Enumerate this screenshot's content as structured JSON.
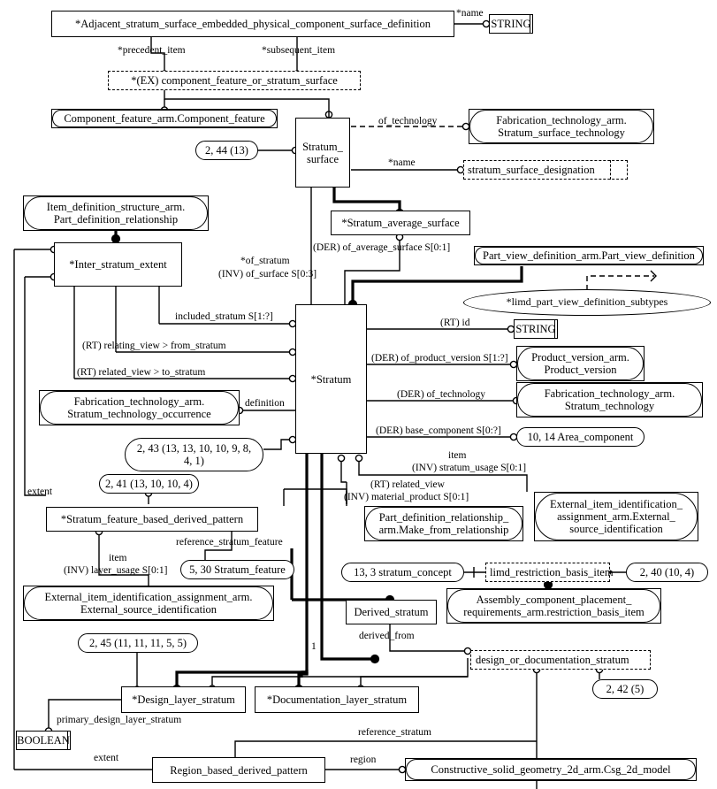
{
  "diagram": {
    "type": "EXPRESS-G entity-level diagram",
    "schema_hint": "layered_interconnect_module_design_arm"
  },
  "nodes": {
    "adjacent_stratum_surface_def": {
      "label": "*Adjacent_stratum_surface_embedded_physical_component_surface_definition",
      "kind": "entity"
    },
    "string_top": {
      "label": "STRING",
      "kind": "simple-type"
    },
    "ex_component_feature_or_stratum_surface": {
      "label": "*(EX) component_feature_or_stratum_surface",
      "kind": "select"
    },
    "component_feature": {
      "label": "Component_feature_arm.Component_feature",
      "kind": "schema-ref"
    },
    "stratum_surface": {
      "label": "Stratum_\nsurface",
      "kind": "entity"
    },
    "pageref_2_44_13": {
      "label": "2, 44 (13)",
      "kind": "page-ref"
    },
    "fab_stratum_surface_technology": {
      "label": "Fabrication_technology_arm.\nStratum_surface_technology",
      "kind": "schema-ref"
    },
    "stratum_surface_designation": {
      "label": "stratum_surface_designation",
      "kind": "defined-type"
    },
    "item_def_structure": {
      "label": "Item_definition_structure_arm.\nPart_definition_relationship",
      "kind": "schema-ref"
    },
    "inter_stratum_extent": {
      "label": "*Inter_stratum_extent",
      "kind": "entity"
    },
    "stratum_average_surface": {
      "label": "*Stratum_average_surface",
      "kind": "entity"
    },
    "part_view_definition": {
      "label": "Part_view_definition_arm.Part_view_definition",
      "kind": "schema-ref"
    },
    "limd_part_view_definition_subtypes": {
      "label": "*limd_part_view_definition_subtypes",
      "kind": "subtype-set"
    },
    "stratum": {
      "label": "*Stratum",
      "kind": "entity"
    },
    "string_id": {
      "label": "STRING",
      "kind": "simple-type"
    },
    "product_version": {
      "label": "Product_version_arm.\nProduct_version",
      "kind": "schema-ref"
    },
    "fab_stratum_technology": {
      "label": "Fabrication_technology_arm.\nStratum_technology",
      "kind": "schema-ref"
    },
    "area_component": {
      "label": "10, 14 Area_component",
      "kind": "page-ref"
    },
    "fab_stratum_technology_occurrence": {
      "label": "Fabrication_technology_arm.\nStratum_technology_occurrence",
      "kind": "schema-ref"
    },
    "pageref_2_43": {
      "label": "2, 43 (13, 13, 10, 10, 9, 8,\n4, 1)",
      "kind": "page-ref"
    },
    "pageref_2_41": {
      "label": "2, 41 (13, 10, 10, 4)",
      "kind": "page-ref"
    },
    "stratum_feature_based_derived_pattern": {
      "label": "*Stratum_feature_based_derived_pattern",
      "kind": "entity"
    },
    "stratum_feature": {
      "label": "5, 30 Stratum_feature",
      "kind": "page-ref"
    },
    "ext_src_id_left": {
      "label": "External_item_identification_assignment_arm.\nExternal_source_identification",
      "kind": "schema-ref"
    },
    "pageref_2_45": {
      "label": "2, 45 (11, 11, 11, 5, 5)",
      "kind": "page-ref"
    },
    "make_from_relationship": {
      "label": "Part_definition_relationship_\narm.Make_from_relationship",
      "kind": "schema-ref"
    },
    "ext_src_id_right": {
      "label": "External_item_identification_\nassignment_arm.External_\nsource_identification",
      "kind": "schema-ref"
    },
    "stratum_concept": {
      "label": "13, 3 stratum_concept",
      "kind": "page-ref"
    },
    "limd_restriction_basis_item": {
      "label": "limd_restriction_basis_item",
      "kind": "select"
    },
    "pageref_2_40": {
      "label": "2, 40 (10, 4)",
      "kind": "page-ref"
    },
    "derived_stratum": {
      "label": "Derived_stratum",
      "kind": "entity"
    },
    "assembly_restriction_basis_item": {
      "label": "Assembly_component_placement_\nrequirements_arm.restriction_basis_item",
      "kind": "schema-ref"
    },
    "design_or_documentation_stratum": {
      "label": "design_or_documentation_stratum",
      "kind": "select"
    },
    "pageref_2_42": {
      "label": "2, 42 (5)",
      "kind": "page-ref"
    },
    "design_layer_stratum": {
      "label": "*Design_layer_stratum",
      "kind": "entity"
    },
    "documentation_layer_stratum": {
      "label": "*Documentation_layer_stratum",
      "kind": "entity"
    },
    "boolean": {
      "label": "BOOLEAN",
      "kind": "simple-type"
    },
    "region_based_derived_pattern": {
      "label": "Region_based_derived_pattern",
      "kind": "entity"
    },
    "csg_2d_model": {
      "label": "Constructive_solid_geometry_2d_arm.Csg_2d_model",
      "kind": "schema-ref"
    }
  },
  "edge_labels": {
    "name_top": "*name",
    "precedent_item": "*precedent_item",
    "subsequent_item": "*subsequent_item",
    "of_technology_surface": "of_technology",
    "name_surface": "*name",
    "of_stratum": "*of_stratum",
    "inv_of_surface": "(INV) of_surface S[0:3]",
    "der_of_average_surface": "(DER) of_average_surface S[0:1]",
    "included_stratum": "included_stratum S[1:?]",
    "rt_relating_view": "(RT) relating_view > from_stratum",
    "rt_related_view_to": "(RT) related_view > to_stratum",
    "definition": "definition",
    "rt_id": "(RT) id",
    "der_of_product_version": "(DER) of_product_version S[1:?]",
    "der_of_technology": "(DER) of_technology",
    "der_base_component": "(DER) base_component S[0:?]",
    "item_stratum_usage_1": "item",
    "item_stratum_usage_2": "(INV) stratum_usage S[0:1]",
    "rt_related_view": "(RT) related_view",
    "inv_material_product": "(INV) material_product S[0:1]",
    "extent_left": "extent",
    "reference_stratum_feature": "reference_stratum_feature",
    "item_layer_usage_1": "item",
    "item_layer_usage_2": "(INV) layer_usage S[0:1]",
    "derived_from": "derived_from",
    "one": "1",
    "primary_design_layer_stratum": "primary_design_layer_stratum",
    "reference_stratum": "reference_stratum",
    "extent_bottom": "extent",
    "region": "region"
  }
}
